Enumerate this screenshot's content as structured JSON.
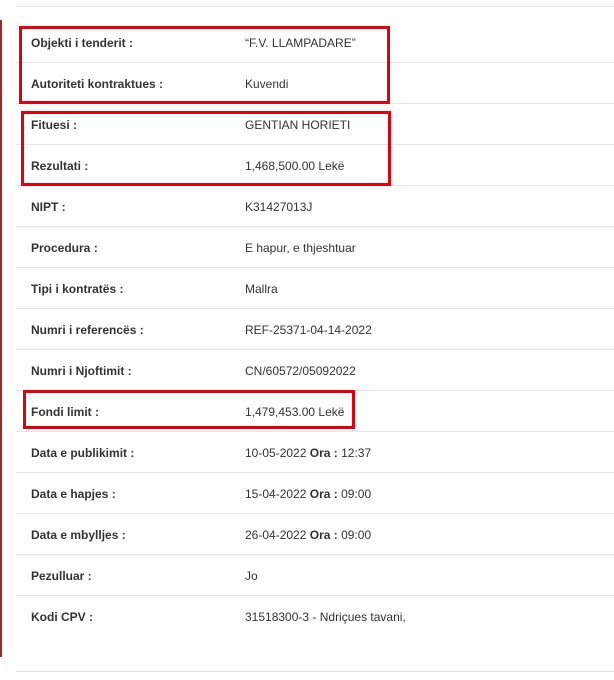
{
  "rows": [
    {
      "label": "Objekti i tenderit :",
      "value": "“F.V. LLAMPADARE”"
    },
    {
      "label": "Autoriteti kontraktues :",
      "value": "Kuvendi"
    },
    {
      "label": "Fituesi :",
      "value": "GENTIAN HORIETI"
    },
    {
      "label": "Rezultati :",
      "value": "1,468,500.00 Lekë"
    },
    {
      "label": "NIPT :",
      "value": "K31427013J"
    },
    {
      "label": "Procedura :",
      "value": "E hapur, e thjeshtuar"
    },
    {
      "label": "Tipi i kontratës :",
      "value": "Mallra"
    },
    {
      "label": "Numri i referencës :",
      "value": "REF-25371-04-14-2022"
    },
    {
      "label": "Numri i Njoftimit :",
      "value": "CN/60572/05092022"
    },
    {
      "label": "Fondi limit :",
      "value": "1,479,453.00 Lekë"
    },
    {
      "label": "Data e publikimit :",
      "date": "10-05-2022",
      "ora_label": "Ora :",
      "time": "12:37"
    },
    {
      "label": "Data e hapjes :",
      "date": "15-04-2022",
      "ora_label": "Ora :",
      "time": "09:00"
    },
    {
      "label": "Data e mbylljes :",
      "date": "26-04-2022",
      "ora_label": "Ora :",
      "time": "09:00"
    },
    {
      "label": "Pezulluar :",
      "value": "Jo"
    },
    {
      "label": "Kodi CPV :",
      "value": "31518300-3 - Ndriçues tavani,"
    }
  ],
  "colors": {
    "highlight": "#e0000f",
    "accent_bar": "#a3262a"
  }
}
